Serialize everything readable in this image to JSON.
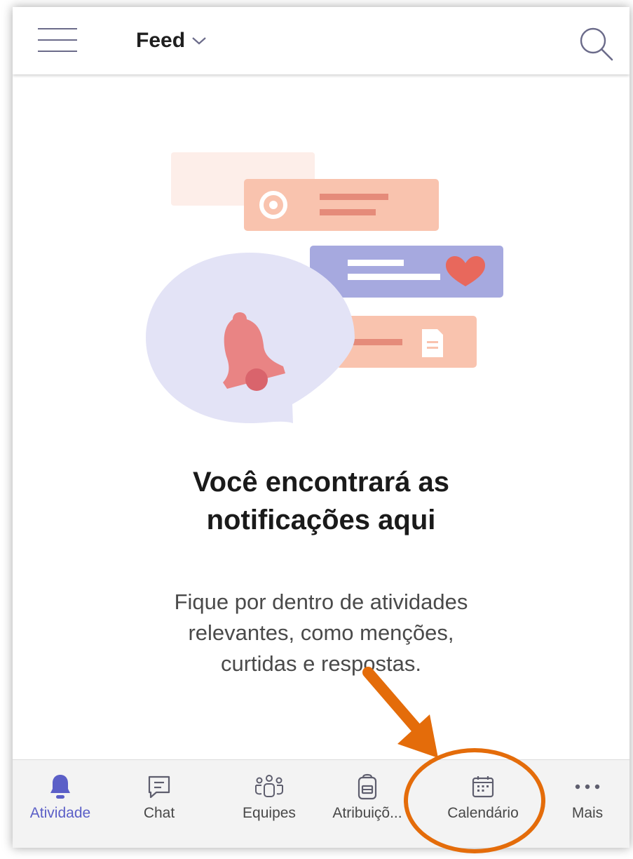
{
  "header": {
    "title": "Feed"
  },
  "icons": {
    "menu": "hamburger-menu-icon",
    "dropdown": "chevron-down-icon",
    "search": "search-icon"
  },
  "empty_state": {
    "headline_line1": "Você encontrará as",
    "headline_line2": "notificações aqui",
    "body_line1": "Fique por dentro de atividades",
    "body_line2": "relevantes, como menções,",
    "body_line3": "curtidas e respostas."
  },
  "bottom_nav": {
    "items": [
      {
        "label": "Atividade",
        "icon": "bell-icon",
        "active": true
      },
      {
        "label": "Chat",
        "icon": "chat-icon",
        "active": false
      },
      {
        "label": "Equipes",
        "icon": "teams-icon",
        "active": false
      },
      {
        "label": "Atribuiçõ...",
        "icon": "assignments-icon",
        "active": false
      },
      {
        "label": "Calendário",
        "icon": "calendar-icon",
        "active": false
      },
      {
        "label": "Mais",
        "icon": "more-icon",
        "active": false
      }
    ]
  },
  "colors": {
    "accent": "#5b5fc7",
    "annotation": "#e46c0a",
    "illustration_peach": "#f9c3ae",
    "illustration_lavender": "#a6a9df",
    "illustration_bell": "#e98484"
  }
}
